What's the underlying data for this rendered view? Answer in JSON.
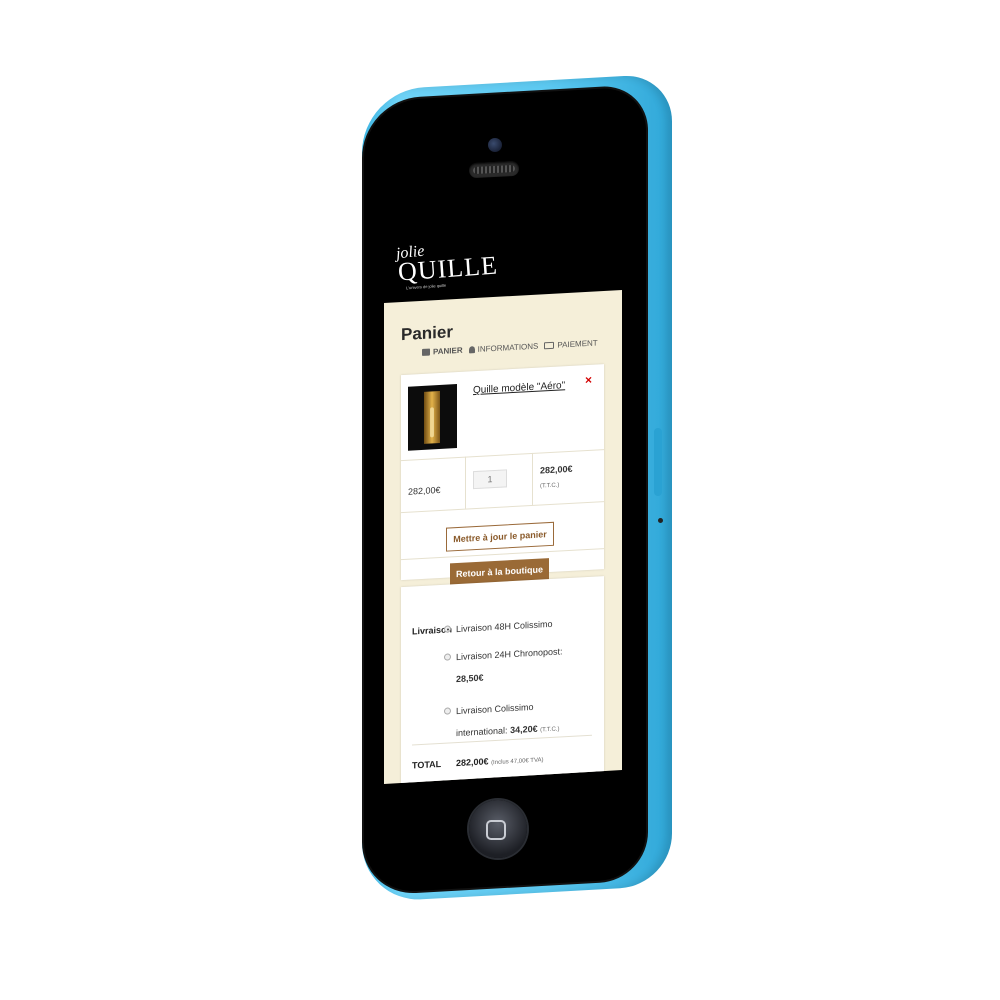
{
  "brand": {
    "logo_script": "jolie",
    "logo_main": "QUILLE",
    "logo_tagline": "L'univers de jolie quille"
  },
  "cart": {
    "title": "Panier",
    "steps": [
      {
        "label": "PANIER",
        "icon": "cart-icon"
      },
      {
        "label": "INFORMATIONS",
        "icon": "user-icon"
      },
      {
        "label": "PAIEMENT",
        "icon": "credit-card-icon"
      }
    ],
    "item": {
      "name": "Quille modèle \"Aéro\"",
      "remove_symbol": "×",
      "unit_price": "282,00€",
      "quantity": "1",
      "subtotal": "282,00€",
      "subtotal_note": "(T.T.C.)"
    },
    "update_button": "Mettre à jour le panier",
    "back_button": "Retour à la boutique"
  },
  "shipping": {
    "label": "Livraison",
    "options": [
      {
        "text": "Livraison 48H Colissimo",
        "selected": true
      },
      {
        "text": "Livraison 24H Chronopost:",
        "price": "28,50€",
        "selected": false
      },
      {
        "text": "Livraison Colissimo",
        "text2": "international:",
        "price": "34,20€",
        "note": "(T.T.C.)",
        "selected": false
      }
    ],
    "total_label": "TOTAL",
    "total_value": "282,00€",
    "total_note": "(Inclus 47,00€ TVA)"
  },
  "colors": {
    "phone": "#5cc9f1",
    "page_bg": "#f5efd9",
    "accent": "#9a6a36",
    "remove": "#d30000"
  }
}
